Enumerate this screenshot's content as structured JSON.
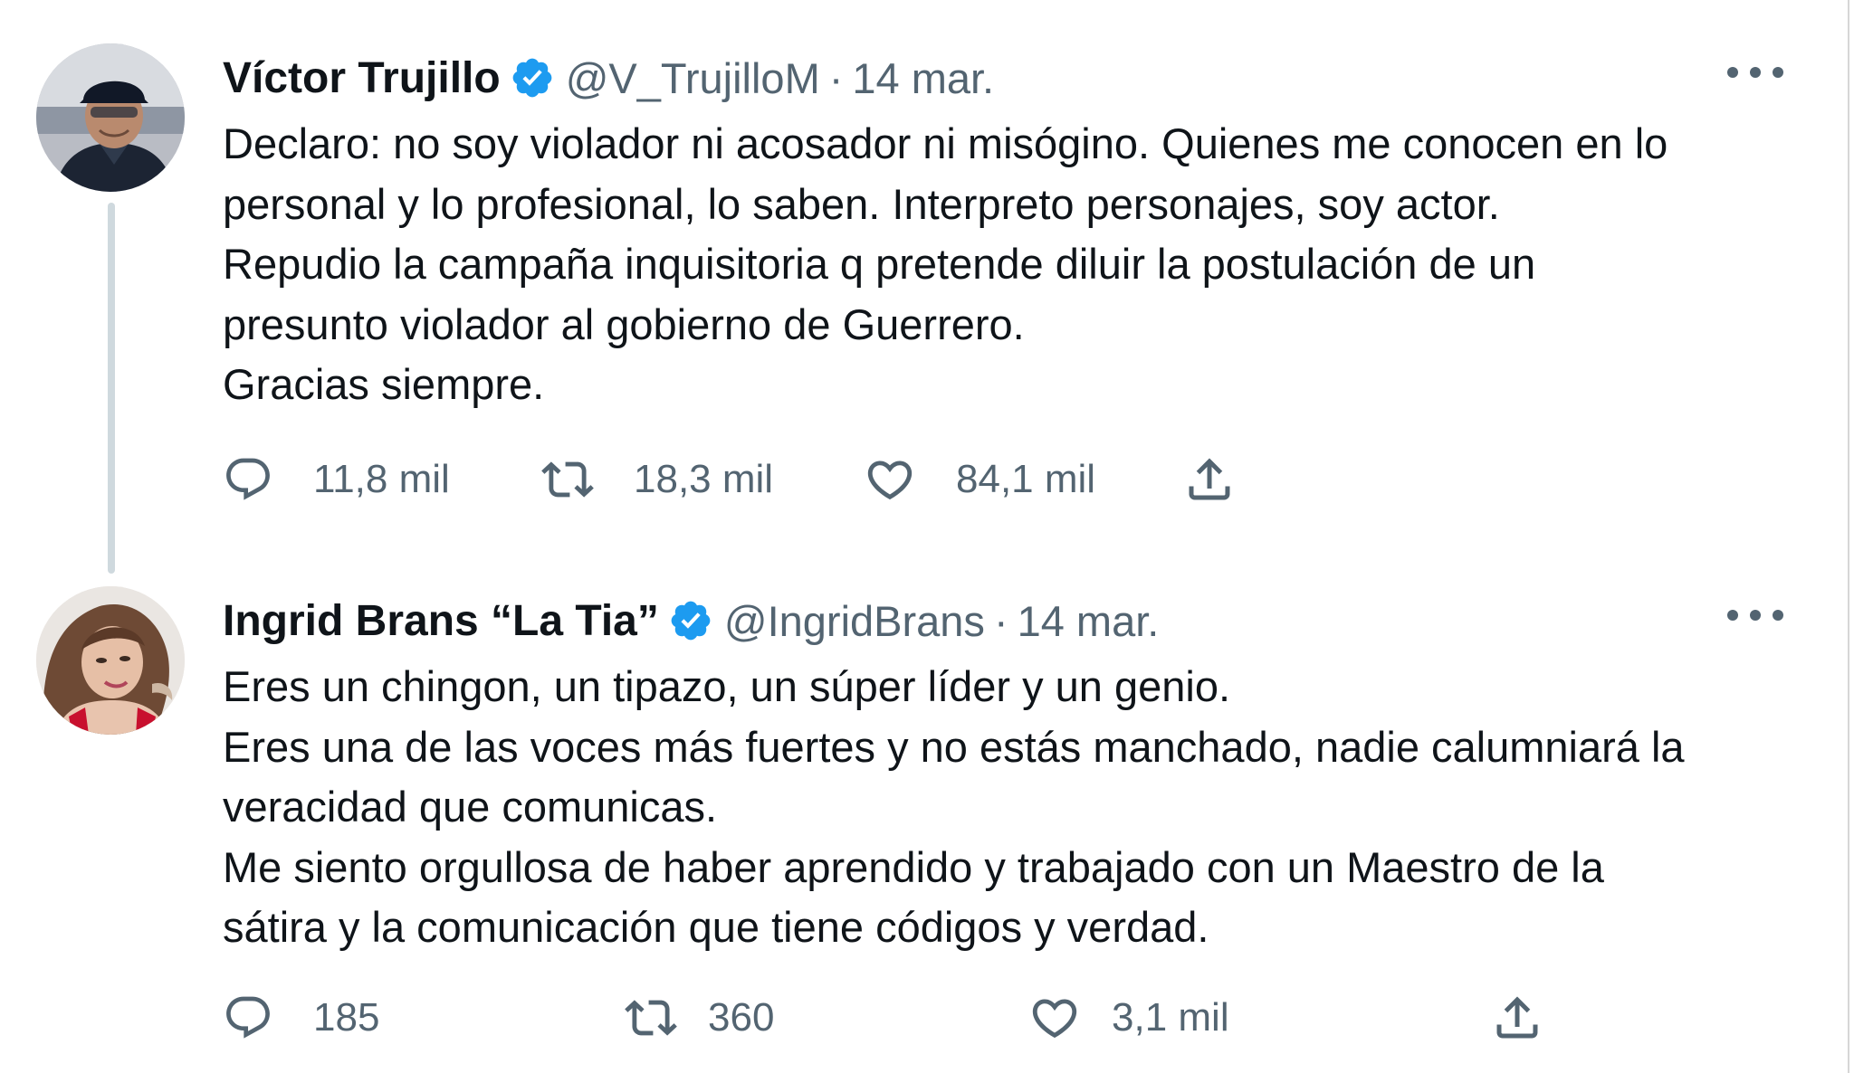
{
  "tweets": [
    {
      "display_name": "Víctor Trujillo",
      "verified": true,
      "handle": "@V_TrujilloM",
      "separator": "·",
      "date": "14 mar.",
      "text_lines": [
        "Declaro: no soy violador ni acosador ni misógino. Quienes me conocen en lo",
        "personal y lo profesional, lo saben. Interpreto personajes, soy actor.",
        "Repudio la campaña inquisitoria q pretende diluir la postulación de un",
        "presunto violador al gobierno de Guerrero.",
        "Gracias siempre."
      ],
      "replies": "11,8 mil",
      "retweets": "18,3 mil",
      "likes": "84,1 mil",
      "has_thread_line": true
    },
    {
      "display_name": "Ingrid Brans “La Tia”",
      "verified": true,
      "handle": "@IngridBrans",
      "separator": "·",
      "date": "14 mar.",
      "text_lines": [
        "Eres un chingon, un tipazo, un súper líder y un genio.",
        "Eres una de las voces más fuertes y no estás manchado, nadie calumniará la",
        "veracidad que comunicas.",
        "Me siento orgullosa de haber aprendido y trabajado con un Maestro de la",
        "sátira y la comunicación que tiene códigos y verdad."
      ],
      "replies": "185",
      "retweets": "360",
      "likes": "3,1 mil",
      "has_thread_line": false
    }
  ],
  "icons": {
    "reply": "reply-icon",
    "retweet": "retweet-icon",
    "like": "heart-icon",
    "share": "share-icon",
    "more": "more-options-icon",
    "verified": "verified-badge-icon"
  },
  "colors": {
    "text_primary": "#0f1419",
    "text_secondary": "#536471",
    "verified_blue": "#1d9bf0",
    "thread_line": "#cfd9de"
  }
}
